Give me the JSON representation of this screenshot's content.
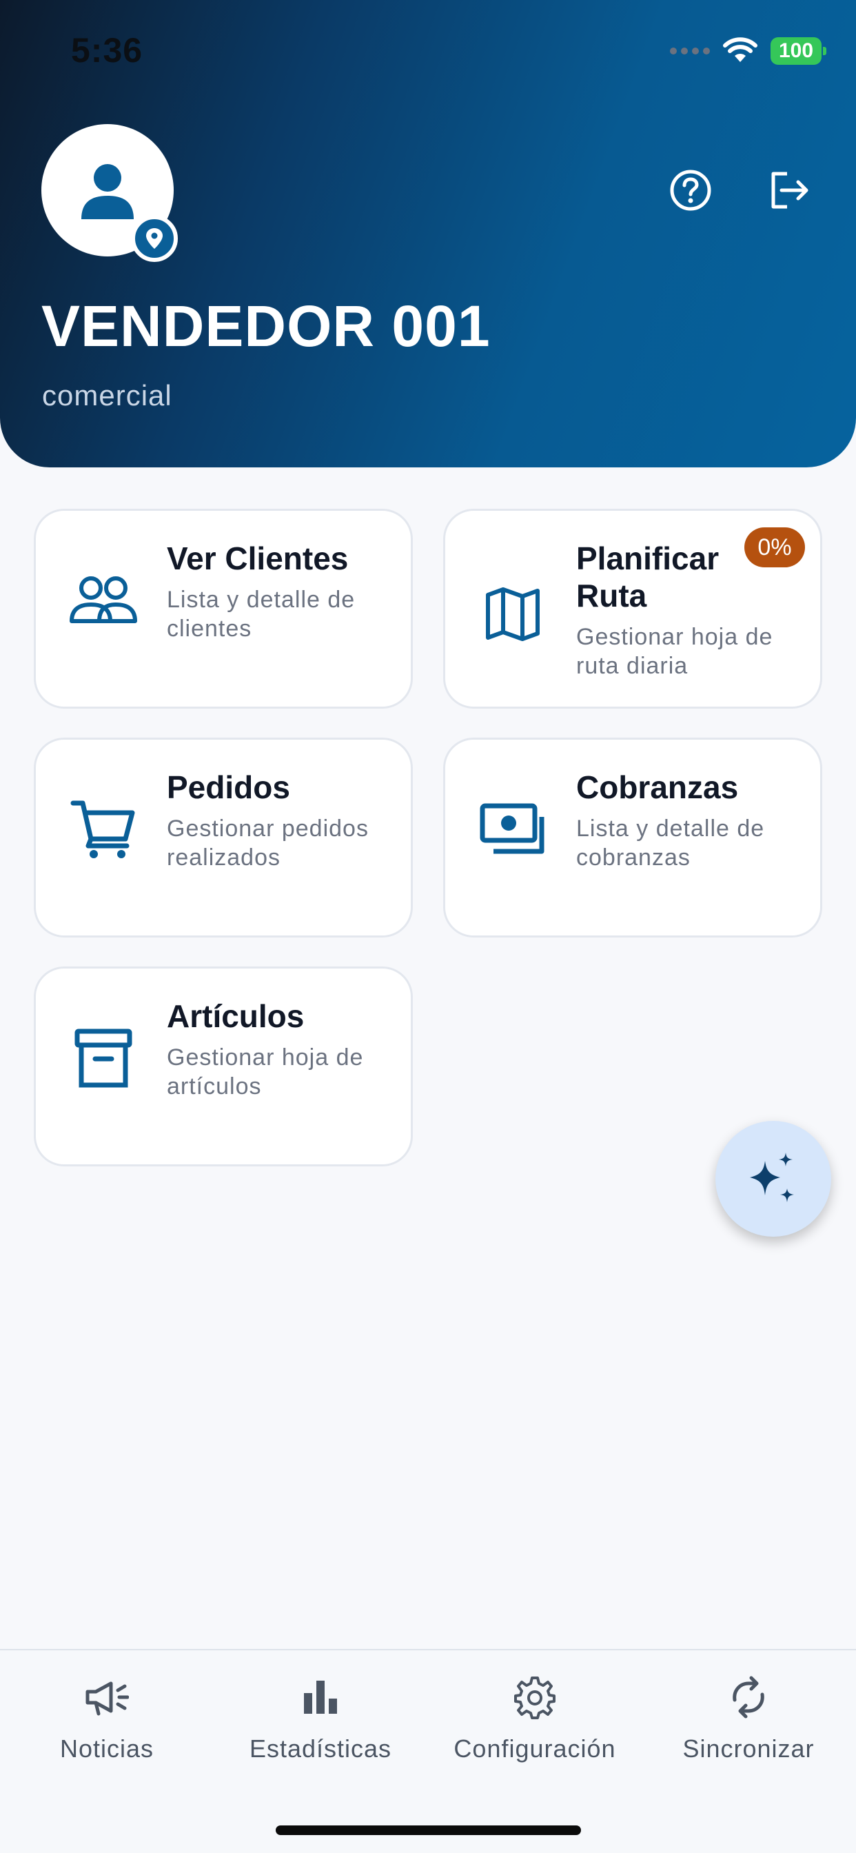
{
  "status_bar": {
    "time": "5:36",
    "battery": "100"
  },
  "profile": {
    "name": "VENDEDOR 001",
    "role": "comercial"
  },
  "cards": [
    {
      "title": "Ver Clientes",
      "subtitle": "Lista y detalle de clientes",
      "icon": "users-icon"
    },
    {
      "title": "Planificar Ruta",
      "subtitle": "Gestionar hoja de ruta diaria",
      "icon": "map-icon",
      "badge": "0%"
    },
    {
      "title": "Pedidos",
      "subtitle": "Gestionar pedidos realizados",
      "icon": "cart-icon"
    },
    {
      "title": "Cobranzas",
      "subtitle": "Lista y detalle de cobranzas",
      "icon": "cash-icon"
    },
    {
      "title": "Artículos",
      "subtitle": "Gestionar hoja de artículos",
      "icon": "archive-box-icon"
    }
  ],
  "bottom_nav": [
    {
      "label": "Noticias",
      "icon": "megaphone-icon"
    },
    {
      "label": "Estadísticas",
      "icon": "bar-chart-icon"
    },
    {
      "label": "Configuración",
      "icon": "gear-icon"
    },
    {
      "label": "Sincronizar",
      "icon": "sync-icon"
    }
  ],
  "colors": {
    "accent": "#0a5f98",
    "badge": "#b5510f",
    "fab": "#d6e6fb",
    "battery": "#35c759"
  }
}
